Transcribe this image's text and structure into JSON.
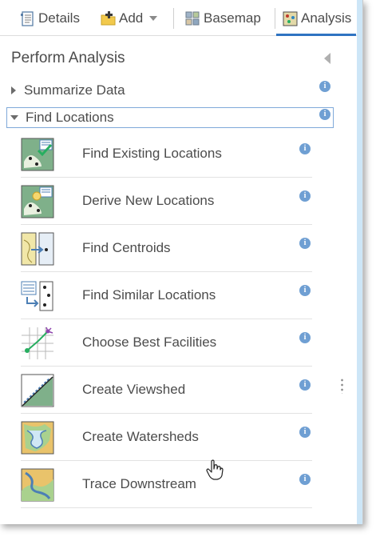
{
  "toolbar": {
    "details": "Details",
    "add": "Add",
    "basemap": "Basemap",
    "analysis": "Analysis"
  },
  "panel": {
    "title": "Perform Analysis"
  },
  "sections": {
    "summarize": "Summarize Data",
    "find": "Find Locations"
  },
  "tools": [
    {
      "label": "Find Existing Locations",
      "icon": "find-existing-locations-icon"
    },
    {
      "label": "Derive New Locations",
      "icon": "derive-new-locations-icon"
    },
    {
      "label": "Find Centroids",
      "icon": "find-centroids-icon"
    },
    {
      "label": "Find Similar Locations",
      "icon": "find-similar-locations-icon"
    },
    {
      "label": "Choose Best Facilities",
      "icon": "choose-best-facilities-icon"
    },
    {
      "label": "Create Viewshed",
      "icon": "create-viewshed-icon"
    },
    {
      "label": "Create Watersheds",
      "icon": "create-watersheds-icon"
    },
    {
      "label": "Trace Downstream",
      "icon": "trace-downstream-icon"
    }
  ],
  "colors": {
    "accent": "#2f73c2",
    "info": "#6f9fd3",
    "text": "#4c4c4c"
  }
}
